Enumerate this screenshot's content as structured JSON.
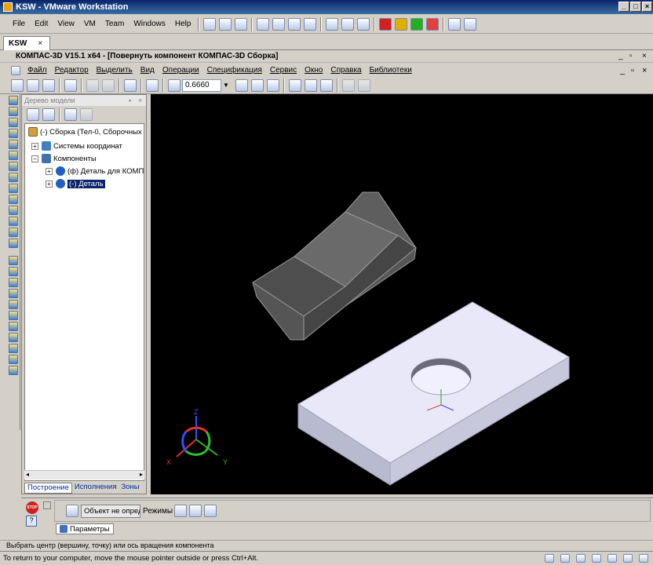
{
  "vmware": {
    "title": "KSW - VMware Workstation",
    "menu": [
      "File",
      "Edit",
      "View",
      "VM",
      "Team",
      "Windows",
      "Help"
    ],
    "tab": "KSW",
    "status": "To return to your computer, move the mouse pointer outside or press Ctrl+Alt."
  },
  "kompas": {
    "title": "КОМПАС-3D V15.1 x64 - [Повернуть компонент КОМПАС-3D Сборка]",
    "menu": [
      "Файл",
      "Редактор",
      "Выделить",
      "Вид",
      "Операции",
      "Спецификация",
      "Сервис",
      "Окно",
      "Справка",
      "Библиотеки"
    ],
    "zoom": "0.6660",
    "tree": {
      "header": "Дерево модели",
      "nodes": [
        {
          "label": "(-) Сборка (Тел-0, Сборочных е"
        },
        {
          "label": "Системы координат",
          "toggle": "+"
        },
        {
          "label": "Компоненты",
          "toggle": "−"
        },
        {
          "label": "(ф) Деталь для КОМП",
          "toggle": "+"
        },
        {
          "label": "(-) Деталь",
          "toggle": "+"
        }
      ],
      "tabs": [
        "Построение",
        "Исполнения",
        "Зоны"
      ]
    },
    "props": {
      "field": "Объект не опреде",
      "modes_label": "Режимы",
      "params_tab": "Параметры",
      "stop_label": "STOP"
    },
    "axes": {
      "x": "X",
      "y": "Y",
      "z": "Z"
    },
    "status": "Выбрать центр (вершину, точку) или ось вращения компонента"
  },
  "colors": {
    "viewport": "#000000",
    "selection": "#0a246a"
  }
}
